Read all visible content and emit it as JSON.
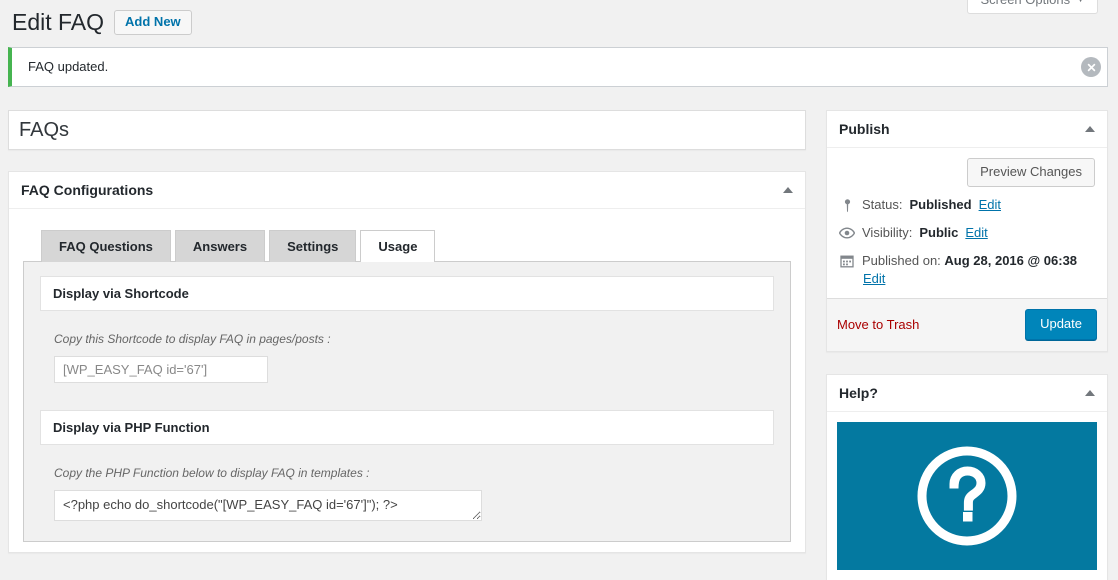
{
  "screen_options": {
    "label": "Screen Options",
    "caret": "chevron-down-icon"
  },
  "header": {
    "title": "Edit FAQ",
    "add_new_label": "Add New"
  },
  "notice": {
    "message": "FAQ updated.",
    "accent_color": "#46b450",
    "dismiss_icon": "close-icon"
  },
  "main": {
    "post_title": "FAQs",
    "configurations": {
      "panel_title": "FAQ Configurations",
      "toggle_icon": "triangle-up-icon",
      "tabs": [
        {
          "label": "FAQ Questions",
          "active": false
        },
        {
          "label": "Answers",
          "active": false
        },
        {
          "label": "Settings",
          "active": false
        },
        {
          "label": "Usage",
          "active": true
        }
      ],
      "usage": {
        "shortcode_section_title": "Display via Shortcode",
        "shortcode_description": "Copy this Shortcode to display FAQ in pages/posts :",
        "shortcode_value": "[WP_EASY_FAQ id='67']",
        "php_section_title": "Display via PHP Function",
        "php_description": "Copy the PHP Function below to display FAQ in templates :",
        "php_value": "<?php echo do_shortcode(\"[WP_EASY_FAQ id='67']\"); ?>"
      }
    }
  },
  "sidebar": {
    "publish": {
      "panel_title": "Publish",
      "toggle_icon": "triangle-up-icon",
      "preview_label": "Preview Changes",
      "status_icon": "pin-icon",
      "status_label": "Status:",
      "status_value": "Published",
      "status_edit": "Edit",
      "visibility_icon": "eye-icon",
      "visibility_label": "Visibility:",
      "visibility_value": "Public",
      "visibility_edit": "Edit",
      "published_icon": "calendar-icon",
      "published_label": "Published on:",
      "published_value": "Aug 28, 2016 @ 06:38",
      "published_edit": "Edit",
      "trash_label": "Move to Trash",
      "update_label": "Update",
      "update_color": "#0085ba"
    },
    "help": {
      "panel_title": "Help?",
      "toggle_icon": "triangle-up-icon",
      "banner_icon": "question-mark-circle-icon",
      "banner_color": "#0479a0"
    }
  }
}
